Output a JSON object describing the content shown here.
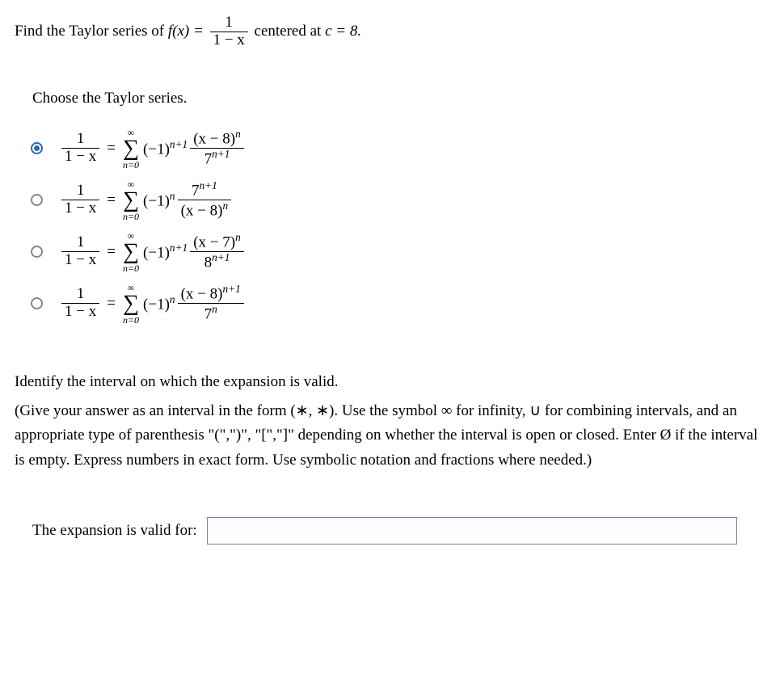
{
  "stem": {
    "prefix": "Find the Taylor series of ",
    "fx": "f(x) = ",
    "frac_num": "1",
    "frac_den": "1 − x",
    "suffix": " centered at ",
    "c_eq": "c = 8."
  },
  "choose_label": "Choose the Taylor series.",
  "options": [
    {
      "selected": true,
      "lhs_num": "1",
      "lhs_den": "1 − x",
      "sum_top": "∞",
      "sum_bot": "n=0",
      "coeff": "(−1)",
      "coeff_exp": "n+1",
      "rhs_num": "(x − 8)",
      "rhs_num_exp": "n",
      "rhs_den": "7",
      "rhs_den_exp": "n+1"
    },
    {
      "selected": false,
      "lhs_num": "1",
      "lhs_den": "1 − x",
      "sum_top": "∞",
      "sum_bot": "n=0",
      "coeff": "(−1)",
      "coeff_exp": "n",
      "rhs_num": "7",
      "rhs_num_exp": "n+1",
      "rhs_den": "(x − 8)",
      "rhs_den_exp": "n"
    },
    {
      "selected": false,
      "lhs_num": "1",
      "lhs_den": "1 − x",
      "sum_top": "∞",
      "sum_bot": "n=0",
      "coeff": "(−1)",
      "coeff_exp": "n+1",
      "rhs_num": "(x − 7)",
      "rhs_num_exp": "n",
      "rhs_den": "8",
      "rhs_den_exp": "n+1"
    },
    {
      "selected": false,
      "lhs_num": "1",
      "lhs_den": "1 − x",
      "sum_top": "∞",
      "sum_bot": "n=0",
      "coeff": "(−1)",
      "coeff_exp": "n",
      "rhs_num": "(x − 8)",
      "rhs_num_exp": "n+1",
      "rhs_den": "7",
      "rhs_den_exp": "n"
    }
  ],
  "part2_heading": "Identify the interval on which the expansion is valid.",
  "part2_instr": "(Give your answer as an interval in the form (∗, ∗). Use the symbol ∞ for infinity, ∪ for combining intervals, and an appropriate type of parenthesis \"(\",\")\", \"[\",\"]\" depending on whether the interval is open or closed. Enter Ø if the interval is empty. Express numbers in exact form. Use symbolic notation and fractions where needed.)",
  "answer_label": "The expansion is valid for:",
  "answer_value": ""
}
